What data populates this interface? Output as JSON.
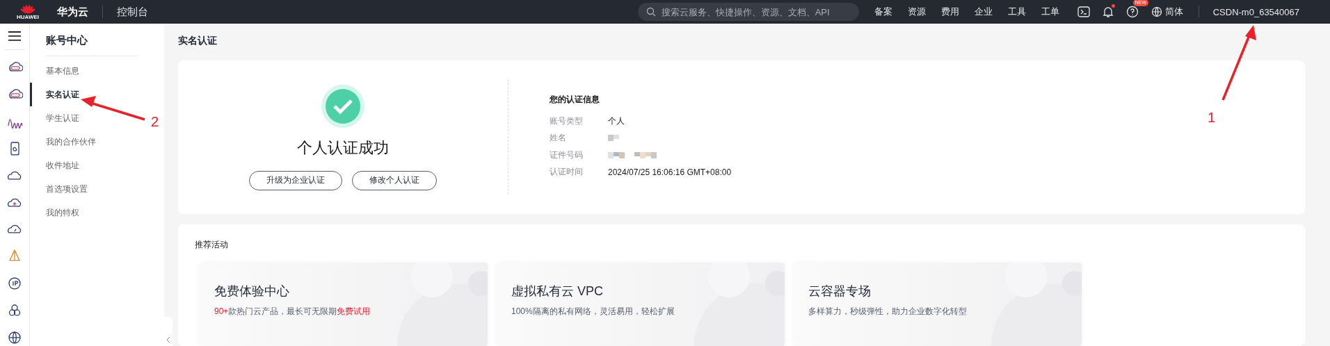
{
  "topbar": {
    "logo_text": "HUAWEI",
    "brand": "华为云",
    "console": "控制台",
    "search": {
      "placeholder": "搜索云服务、快捷操作、资源、文档、API"
    },
    "nav": [
      "备案",
      "资源",
      "费用",
      "企业",
      "工具",
      "工单"
    ],
    "notifications": {
      "unread": true
    },
    "help_badge": "NEW",
    "language": "简体",
    "user": "CSDN-m0_63540067"
  },
  "rail": {
    "icons": [
      {
        "kind": "cloud-box"
      },
      {
        "kind": "cloud-box"
      },
      {
        "kind": "waves"
      },
      {
        "kind": "phone"
      },
      {
        "kind": "cloud"
      },
      {
        "kind": "cloud-up"
      },
      {
        "kind": "cloud-gauge"
      },
      {
        "kind": "pyramid"
      },
      {
        "kind": "ip"
      },
      {
        "kind": "circles"
      },
      {
        "kind": "globe"
      }
    ]
  },
  "sidebar": {
    "title": "账号中心",
    "items": [
      {
        "label": "基本信息",
        "selected": false
      },
      {
        "label": "实名认证",
        "selected": true
      },
      {
        "label": "学生认证",
        "selected": false
      },
      {
        "label": "我的合作伙伴",
        "selected": false
      },
      {
        "label": "收件地址",
        "selected": false
      },
      {
        "label": "首选项设置",
        "selected": false
      },
      {
        "label": "我的特权",
        "selected": false
      }
    ]
  },
  "page_title": "实名认证",
  "status": {
    "heading": "个人认证成功",
    "success": true,
    "buttons": [
      "升级为企业认证",
      "修改个人认证"
    ]
  },
  "info": {
    "title": "您的认证信息",
    "rows": [
      {
        "label": "账号类型",
        "value": "个人",
        "redacted": false
      },
      {
        "label": "姓名",
        "redacted": true
      },
      {
        "label": "证件号码",
        "redacted": true
      },
      {
        "label": "认证时间",
        "value": "2024/07/25 16:06:16 GMT+08:00",
        "redacted": false
      }
    ]
  },
  "activities": {
    "title": "推荐活动",
    "cards": [
      {
        "title": "免费体验中心",
        "description": [
          {
            "text": "90+",
            "highlight": true
          },
          {
            "text": "款热门云产品，最长可无限期",
            "highlight": false
          },
          {
            "text": "免费试用",
            "highlight": true
          }
        ]
      },
      {
        "title": "虚拟私有云 VPC",
        "description": [
          {
            "text": "100%隔离的私有网络，灵活易用，轻松扩展",
            "highlight": false
          }
        ]
      },
      {
        "title": "云容器专场",
        "description": [
          {
            "text": "多样算力，秒级弹性，助力企业数字化转型",
            "highlight": false
          }
        ]
      }
    ]
  },
  "annotations": [
    {
      "label": "1"
    },
    {
      "label": "2"
    }
  ]
}
